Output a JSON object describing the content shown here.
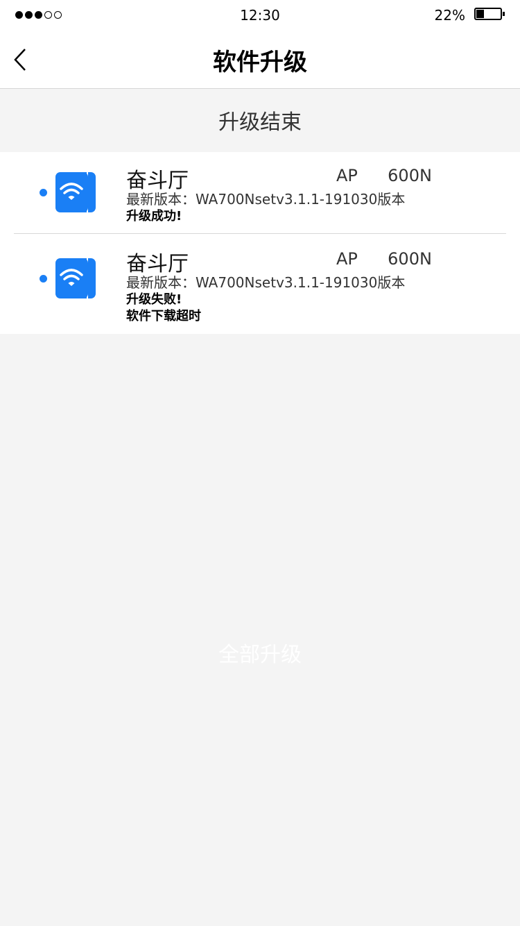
{
  "status_bar": {
    "time": "12:30",
    "battery_percent": "22%",
    "battery_level": 0.22,
    "signal_bars_filled": 3,
    "signal_bars_total": 5
  },
  "nav": {
    "title": "软件升级",
    "back_icon": "chevron-left-icon"
  },
  "section": {
    "title": "升级结束"
  },
  "devices": [
    {
      "name": "奋斗厅",
      "model": "AP  600N",
      "version": "最新版本：WA700Nsetv3.1.1-191030版本",
      "status": "升级成功!",
      "detail": ""
    },
    {
      "name": "奋斗厅",
      "model": "AP  600N",
      "version": "最新版本：WA700Nsetv3.1.1-191030版本",
      "status": "升级失败!",
      "detail": "软件下载超时"
    }
  ],
  "footer": {
    "upgrade_all_label": "全部升级"
  },
  "colors": {
    "accent": "#1a7ff5",
    "background": "#f4f4f4"
  }
}
